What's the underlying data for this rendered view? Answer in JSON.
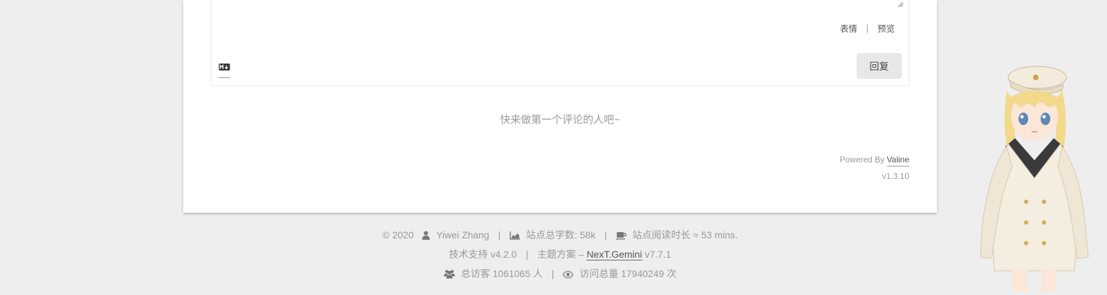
{
  "comment": {
    "tools": {
      "emoji_label": "表情",
      "separator": "|",
      "preview_label": "预览"
    },
    "markdown_icon": "markdown-icon",
    "reply_label": "回复",
    "empty_message": "快来做第一个评论的人吧~",
    "powered_by_prefix": "Powered By",
    "powered_by_brand": "Valine",
    "version": "v1.3.10"
  },
  "footer": {
    "line1": {
      "copyright": "© 2020",
      "author_icon": "user-icon",
      "author": "Yiwei Zhang",
      "sep": "|",
      "wordcount_icon": "area-chart-icon",
      "wordcount": "站点总字数: 58k",
      "readtime_icon": "coffee-icon",
      "readtime": "站点阅读时长 ≈ 53 mins."
    },
    "line2": {
      "tech_support": "技术支持 v4.2.0",
      "sep": "|",
      "theme_prefix": "主题方案 –",
      "theme_link": "NexT.Gemini",
      "theme_version": "v7.7.1"
    },
    "line3": {
      "visitors_icon": "users-icon",
      "visitors": "总访客 1061065 人",
      "sep": "|",
      "views_icon": "eye-icon",
      "views": "访问总量 17940249 次"
    }
  },
  "colors": {
    "background": "#eeeeee",
    "card": "#ffffff",
    "muted_text": "#999999",
    "body_text": "#555555",
    "button_bg": "#e8e8e8"
  },
  "mascot_icon": "live2d-mascot-illustration"
}
